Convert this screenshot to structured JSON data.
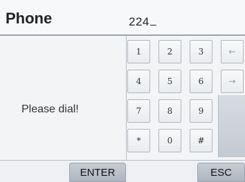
{
  "header": {
    "title": "Phone",
    "dialed_number": "224"
  },
  "prompt": "Please dial!",
  "keypad": {
    "row1": [
      "1",
      "2",
      "3",
      "←"
    ],
    "row2": [
      "4",
      "5",
      "6",
      "→"
    ],
    "row3": [
      "7",
      "8",
      "9"
    ],
    "row4": [
      "*",
      "0",
      "#"
    ]
  },
  "buttons": {
    "enter": "ENTER",
    "esc": "ESC"
  }
}
